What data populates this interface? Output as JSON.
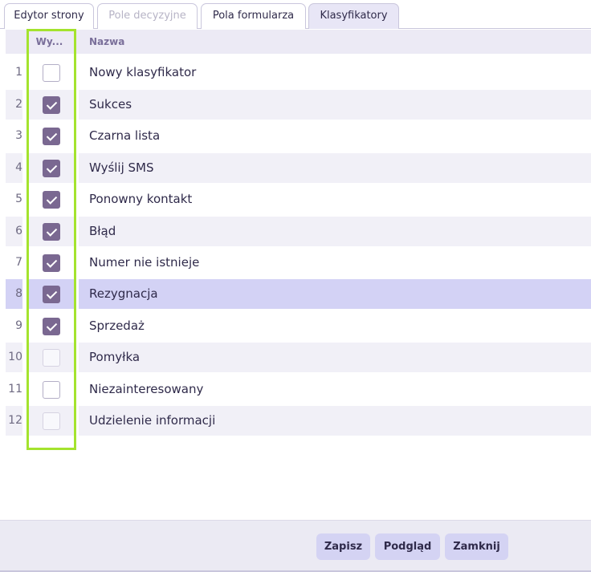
{
  "tabs": [
    {
      "label": "Edytor strony",
      "state": "normal"
    },
    {
      "label": "Pole decyzyjne",
      "state": "disabled"
    },
    {
      "label": "Pola formularza",
      "state": "normal"
    },
    {
      "label": "Klasyfikatory",
      "state": "active"
    }
  ],
  "grid": {
    "columns": {
      "selected": "Wy...",
      "name": "Nazwa"
    },
    "rows": [
      {
        "num": "1",
        "name": "Nowy klasyfikator",
        "checked": false
      },
      {
        "num": "2",
        "name": "Sukces",
        "checked": true
      },
      {
        "num": "3",
        "name": "Czarna lista",
        "checked": true
      },
      {
        "num": "4",
        "name": "Wyślij SMS",
        "checked": true
      },
      {
        "num": "5",
        "name": "Ponowny kontakt",
        "checked": true
      },
      {
        "num": "6",
        "name": "Błąd",
        "checked": true
      },
      {
        "num": "7",
        "name": "Numer nie istnieje",
        "checked": true
      },
      {
        "num": "8",
        "name": "Rezygnacja",
        "checked": true,
        "selected": true
      },
      {
        "num": "9",
        "name": "Sprzedaż",
        "checked": true
      },
      {
        "num": "10",
        "name": "Pomyłka",
        "checked": false
      },
      {
        "num": "11",
        "name": "Niezainteresowany",
        "checked": false
      },
      {
        "num": "12",
        "name": "Udzielenie informacji",
        "checked": false
      }
    ]
  },
  "footer": {
    "save": "Zapisz",
    "preview": "Podgląd",
    "close": "Zamknij"
  },
  "colors": {
    "accent": "#7a6891",
    "selected_row": "#d3d2f5",
    "highlight": "#a4e32e",
    "button": "#d4d3f3"
  }
}
